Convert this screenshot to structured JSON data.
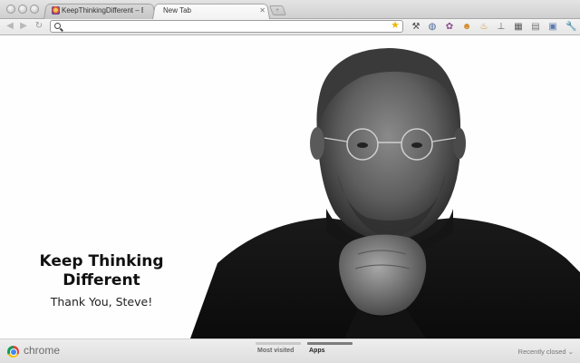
{
  "tabs": [
    {
      "title": "KeepThinkingDifferent – Ed",
      "active": false
    },
    {
      "title": "New Tab",
      "active": true
    }
  ],
  "omnibox": {
    "value": "",
    "placeholder": ""
  },
  "extensions": [
    "wrench-tool-icon",
    "globe-icon",
    "puzzle-icon",
    "emoji-icon",
    "mug-icon",
    "scale-icon",
    "grid-icon",
    "card-icon",
    "window-icon"
  ],
  "main": {
    "headline_line1": "Keep Thinking",
    "headline_line2": "Different",
    "subline": "Thank You, Steve!"
  },
  "bottombar": {
    "brand": "chrome",
    "sections": [
      {
        "label": "Most visited",
        "active": false
      },
      {
        "label": "Apps",
        "active": true
      }
    ],
    "recently_closed": "Recently closed"
  },
  "colors": {
    "star": "#e9b812",
    "photo_background": "#fefefe"
  }
}
